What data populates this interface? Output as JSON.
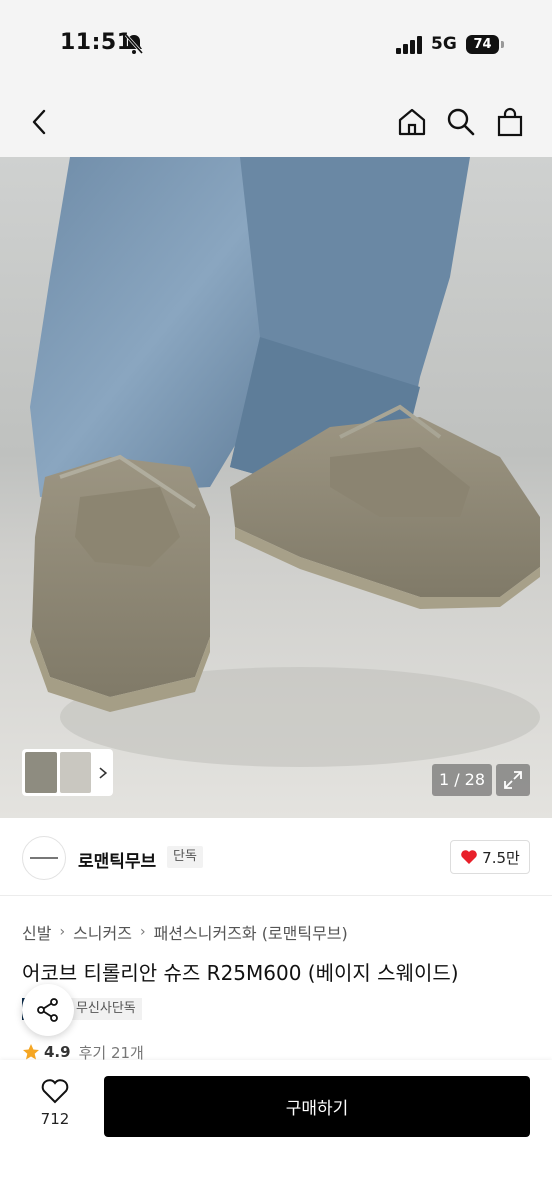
{
  "status_bar": {
    "time": "11:51",
    "network": "5G",
    "battery": "74"
  },
  "header": {
    "back_icon": "chevron-left-icon",
    "home_icon": "home-icon",
    "search_icon": "search-icon",
    "cart_icon": "shopping-bag-icon"
  },
  "gallery": {
    "counter": "1 / 28",
    "expand_icon": "expand-icon"
  },
  "brand": {
    "name": "로맨틱무브",
    "tag": "단독",
    "likes": "7.5만"
  },
  "breadcrumb": [
    "신발",
    "스니커즈",
    "패션스니커즈화 (로맨틱무브)"
  ],
  "product": {
    "title": "어코브 티롤리안 슈즈 R25M600 (베이지 스웨이드)",
    "badge_dark": "이",
    "badge_light": "무신사단독",
    "rating": "4.9",
    "reviews": "후기 21개"
  },
  "bottom_bar": {
    "wish_count": "712",
    "buy_label": "구매하기"
  },
  "colors": {
    "accent_heart": "#e8202a",
    "buy_button": "#000000",
    "badge_dark": "#0d2c4a",
    "star": "#f5a623"
  }
}
